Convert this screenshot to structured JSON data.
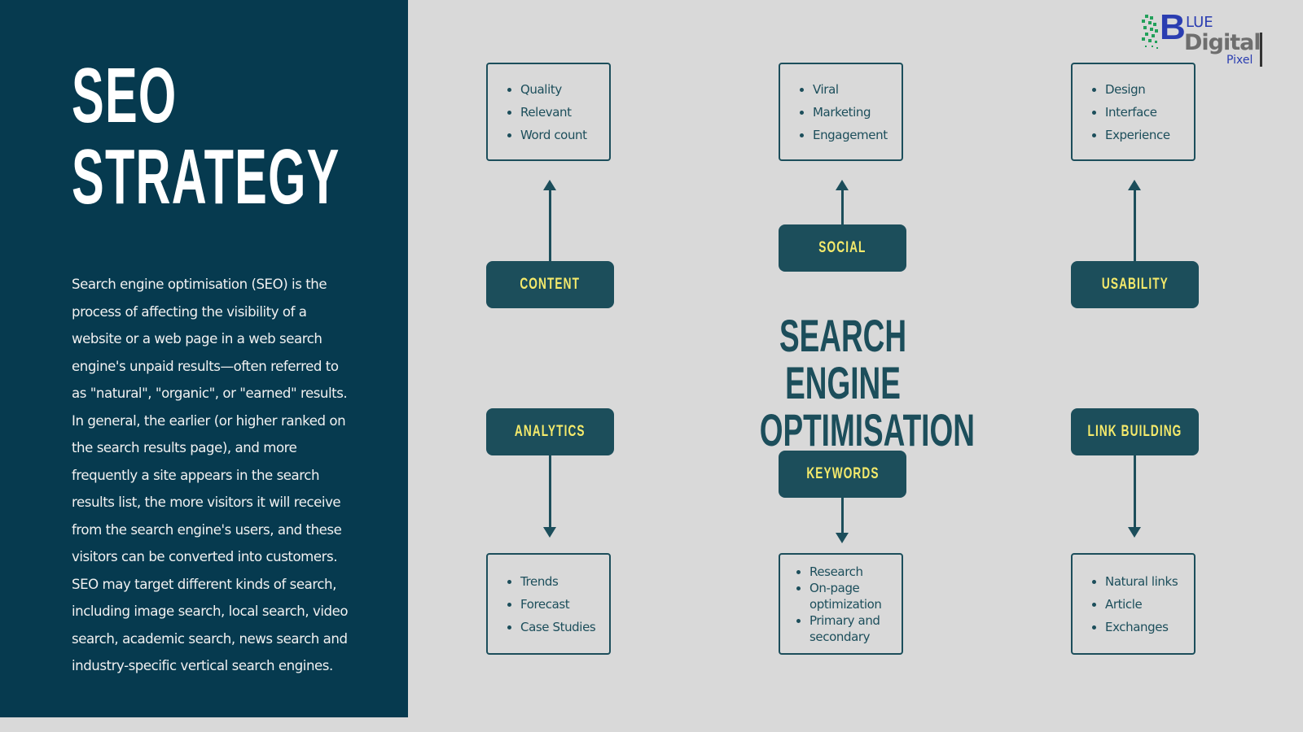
{
  "title": {
    "line1": "SEO",
    "line2": "STRATEGY"
  },
  "description": "Search engine optimisation (SEO) is the process of affecting the visibility of a website or a web page in a web search engine's unpaid results—often referred to as \"natural\", \"organic\", or \"earned\" results. In general, the earlier (or higher ranked on the search results page), and more frequently a site appears in the search results list, the more visitors it will receive from the search engine's users, and these visitors can be converted into customers. SEO may target different kinds of search, including image search, local search, video search, academic search, news search and industry-specific vertical search engines.",
  "logo": {
    "letter": "B",
    "line1": "LUE",
    "line2": "Digital",
    "line3": "Pixel"
  },
  "center": {
    "line1": "SEARCH ENGINE",
    "line2": "OPTIMISATION"
  },
  "colors": {
    "left_panel": "#063a4f",
    "background": "#d9d9d9",
    "box": "#1c4e5b",
    "label": "#f5ea6b"
  },
  "categories": {
    "content": {
      "label": "CONTENT",
      "items": [
        "Quality",
        "Relevant",
        "Word count"
      ]
    },
    "social": {
      "label": "SOCIAL",
      "items": [
        "Viral",
        "Marketing",
        "Engagement"
      ]
    },
    "usability": {
      "label": "USABILITY",
      "items": [
        "Design",
        "Interface",
        "Experience"
      ]
    },
    "analytics": {
      "label": "ANALYTICS",
      "items": [
        "Trends",
        "Forecast",
        "Case Studies"
      ]
    },
    "keywords": {
      "label": "KEYWORDS",
      "items": [
        "Research",
        "On-page optimization",
        "Primary and secondary"
      ]
    },
    "link_building": {
      "label": "LINK BUILDING",
      "items": [
        "Natural links",
        "Article",
        "Exchanges"
      ]
    }
  }
}
